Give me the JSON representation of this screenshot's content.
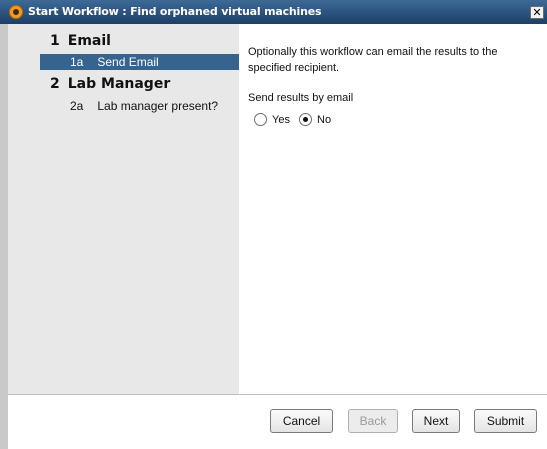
{
  "window": {
    "title": "Start Workflow : Find orphaned virtual machines",
    "close_glyph": "✕"
  },
  "sidebar": {
    "groups": [
      {
        "number": "1",
        "label": "Email",
        "substeps": [
          {
            "code": "1a",
            "label": "Send Email",
            "selected": true
          }
        ]
      },
      {
        "number": "2",
        "label": "Lab Manager",
        "substeps": [
          {
            "code": "2a",
            "label": "Lab manager present?",
            "selected": false
          }
        ]
      }
    ]
  },
  "content": {
    "description": "Optionally this workflow can email the results to the specified recipient.",
    "field_label": "Send results by email",
    "options": [
      {
        "label": "Yes",
        "checked": false
      },
      {
        "label": "No",
        "checked": true
      }
    ]
  },
  "footer": {
    "cancel_label": "Cancel",
    "back_label": "Back",
    "next_label": "Next",
    "submit_label": "Submit"
  },
  "colors": {
    "titlebar": "#1d3e66",
    "selected_step": "#37638f",
    "sidebar_bg": "#e8e8e8"
  }
}
